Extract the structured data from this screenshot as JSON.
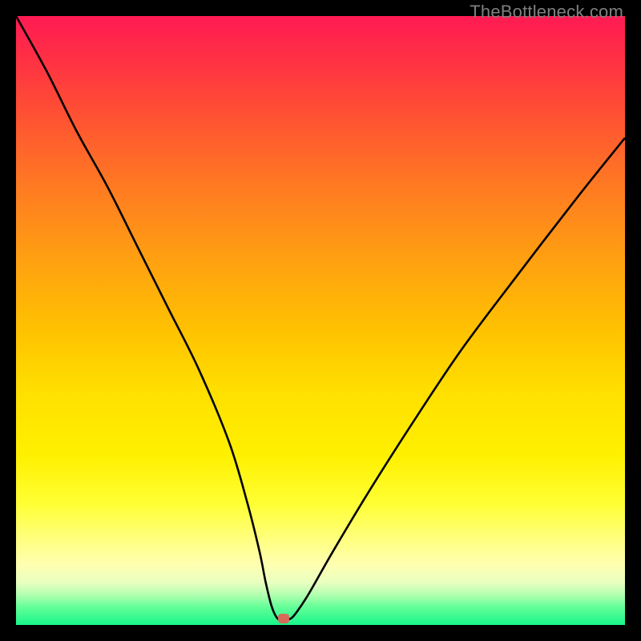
{
  "watermark": "TheBottleneck.com",
  "chart_data": {
    "type": "line",
    "title": "",
    "xlabel": "",
    "ylabel": "",
    "xlim": [
      0,
      100
    ],
    "ylim": [
      0,
      100
    ],
    "grid": false,
    "background_gradient": "red-to-green-vertical",
    "series": [
      {
        "name": "bottleneck-curve",
        "x": [
          0,
          5,
          10,
          15,
          20,
          25,
          30,
          35,
          38,
          40,
          41,
          42,
          43,
          44,
          45,
          46,
          48,
          52,
          58,
          65,
          73,
          82,
          92,
          100
        ],
        "y": [
          100,
          91,
          81,
          72,
          62,
          52,
          42,
          30,
          20,
          12,
          7,
          3,
          1,
          1,
          1,
          2,
          5,
          12,
          22,
          33,
          45,
          57,
          70,
          80
        ]
      }
    ],
    "marker": {
      "x": 44,
      "y": 1,
      "color": "#d86a5a"
    }
  }
}
